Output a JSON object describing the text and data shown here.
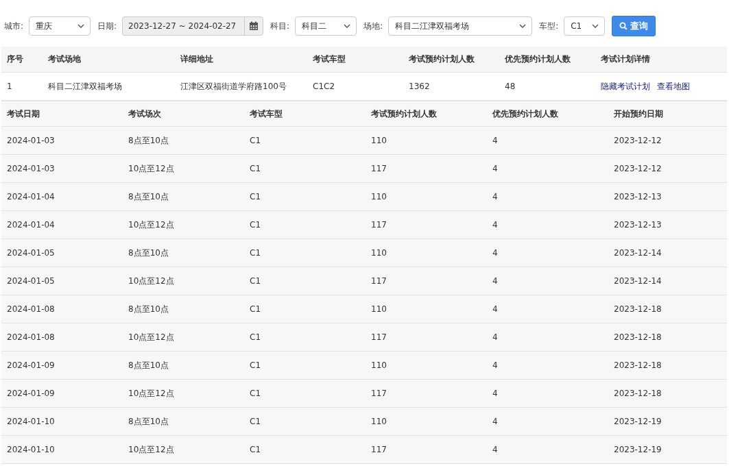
{
  "filters": [
    {
      "kind": "select",
      "label": "城市:",
      "value": "重庆"
    },
    {
      "kind": "date",
      "label": "日期:",
      "value": "2023-12-27 ~ 2024-02-27"
    },
    {
      "kind": "select",
      "label": "科目:",
      "value": "科目二"
    },
    {
      "kind": "select",
      "label": "场地:",
      "value": "科目二江津双福考场"
    },
    {
      "kind": "select",
      "label": "车型:",
      "value": "C1"
    }
  ],
  "search_button": "查询",
  "table": {
    "columns": [
      "序号",
      "考试场地",
      "详细地址",
      "考试车型",
      "考试预约计划人数",
      "优先预约计划人数",
      "考试计划详情"
    ],
    "rows": [
      {
        "cells": [
          "1",
          "科目二江津双福考场",
          "江津区双福街道学府路100号",
          "C1C2",
          "1362",
          "48"
        ],
        "links": [
          "隐藏考试计划",
          "查看地图"
        ]
      }
    ]
  },
  "plan_table": {
    "columns": [
      "考试日期",
      "考试场次",
      "考试车型",
      "考试预约计划人数",
      "优先预约计划人数",
      "开始预约日期"
    ],
    "rows": [
      [
        "2024-01-03",
        "8点至10点",
        "C1",
        "110",
        "4",
        "2023-12-12"
      ],
      [
        "2024-01-03",
        "10点至12点",
        "C1",
        "117",
        "4",
        "2023-12-12"
      ],
      [
        "2024-01-04",
        "8点至10点",
        "C1",
        "110",
        "4",
        "2023-12-13"
      ],
      [
        "2024-01-04",
        "10点至12点",
        "C1",
        "117",
        "4",
        "2023-12-13"
      ],
      [
        "2024-01-05",
        "8点至10点",
        "C1",
        "110",
        "4",
        "2023-12-14"
      ],
      [
        "2024-01-05",
        "10点至12点",
        "C1",
        "117",
        "4",
        "2023-12-14"
      ],
      [
        "2024-01-08",
        "8点至10点",
        "C1",
        "110",
        "4",
        "2023-12-18"
      ],
      [
        "2024-01-08",
        "10点至12点",
        "C1",
        "117",
        "4",
        "2023-12-18"
      ],
      [
        "2024-01-09",
        "8点至10点",
        "C1",
        "110",
        "4",
        "2023-12-18"
      ],
      [
        "2024-01-09",
        "10点至12点",
        "C1",
        "117",
        "4",
        "2023-12-18"
      ],
      [
        "2024-01-10",
        "8点至10点",
        "C1",
        "110",
        "4",
        "2023-12-19"
      ],
      [
        "2024-01-10",
        "10点至12点",
        "C1",
        "117",
        "4",
        "2023-12-19"
      ]
    ]
  }
}
